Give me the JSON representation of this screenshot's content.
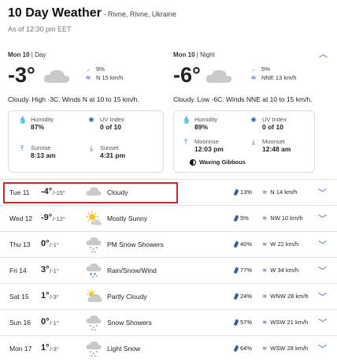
{
  "header": {
    "title": "10 Day Weather",
    "location": " - Rivne, Rivne, Ukraine",
    "as_of": "As of 12:30 pm EET"
  },
  "today": {
    "day": {
      "label_bold": "Mon 10",
      "label_rest": " | Day",
      "temp": "-3°",
      "precip": "9%",
      "wind": "N 15 km/h",
      "desc": "Cloudy. High -3C. Winds N at 10 to 15 km/h.",
      "humidity_label": "Humidity",
      "humidity": "87%",
      "uv_label": "UV Index",
      "uv": "0 of 10",
      "sunrise_label": "Sunrise",
      "sunrise": "8:13 am",
      "sunset_label": "Sunset",
      "sunset": "4:31 pm"
    },
    "night": {
      "label_bold": "Mon 10",
      "label_rest": " | Night",
      "temp": "-6°",
      "precip": "5%",
      "wind": "NNE 13 km/h",
      "desc": "Cloudy. Low -6C. Winds NNE at 10 to 15 km/h.",
      "humidity_label": "Humidity",
      "humidity": "89%",
      "uv_label": "UV Index",
      "uv": "0 of 10",
      "moonrise_label": "Moonrise",
      "moonrise": "12:03 pm",
      "moonset_label": "Moonset",
      "moonset": "12:48 am",
      "moon_phase": "Waxing Gibbous"
    }
  },
  "forecast": [
    {
      "date": "Tue 11",
      "hi": "-4°",
      "lo": "/-15°",
      "icon": "cloud-icon",
      "cond": "Cloudy",
      "precip": "13%",
      "wind": "N 14 km/h"
    },
    {
      "date": "Wed 12",
      "hi": "-9°",
      "lo": "/-12°",
      "icon": "sun-icon",
      "cond": "Mostly Sunny",
      "precip": "5%",
      "wind": "NW 10 km/h"
    },
    {
      "date": "Thu 13",
      "hi": "0°",
      "lo": "/-1°",
      "icon": "snow-cloud-icon",
      "cond": "PM Snow Showers",
      "precip": "40%",
      "wind": "W 22 km/h"
    },
    {
      "date": "Fri 14",
      "hi": "3°",
      "lo": "/-1°",
      "icon": "rain-snow-cloud-icon",
      "cond": "Rain/Snow/Wind",
      "precip": "77%",
      "wind": "W 34 km/h"
    },
    {
      "date": "Sat 15",
      "hi": "1°",
      "lo": "/-3°",
      "icon": "partly-cloudy-icon",
      "cond": "Partly Cloudy",
      "precip": "24%",
      "wind": "WNW 28 km/h"
    },
    {
      "date": "Sun 16",
      "hi": "0°",
      "lo": "/-1°",
      "icon": "snow-cloud-icon",
      "cond": "Snow Showers",
      "precip": "57%",
      "wind": "WSW 21 km/h"
    },
    {
      "date": "Mon 17",
      "hi": "1°",
      "lo": "/-3°",
      "icon": "snow-cloud-icon",
      "cond": "Light Snow",
      "precip": "64%",
      "wind": "WSW 28 km/h"
    }
  ],
  "colors": {
    "accent": "#2f64b8",
    "highlight": "#dd2222"
  }
}
